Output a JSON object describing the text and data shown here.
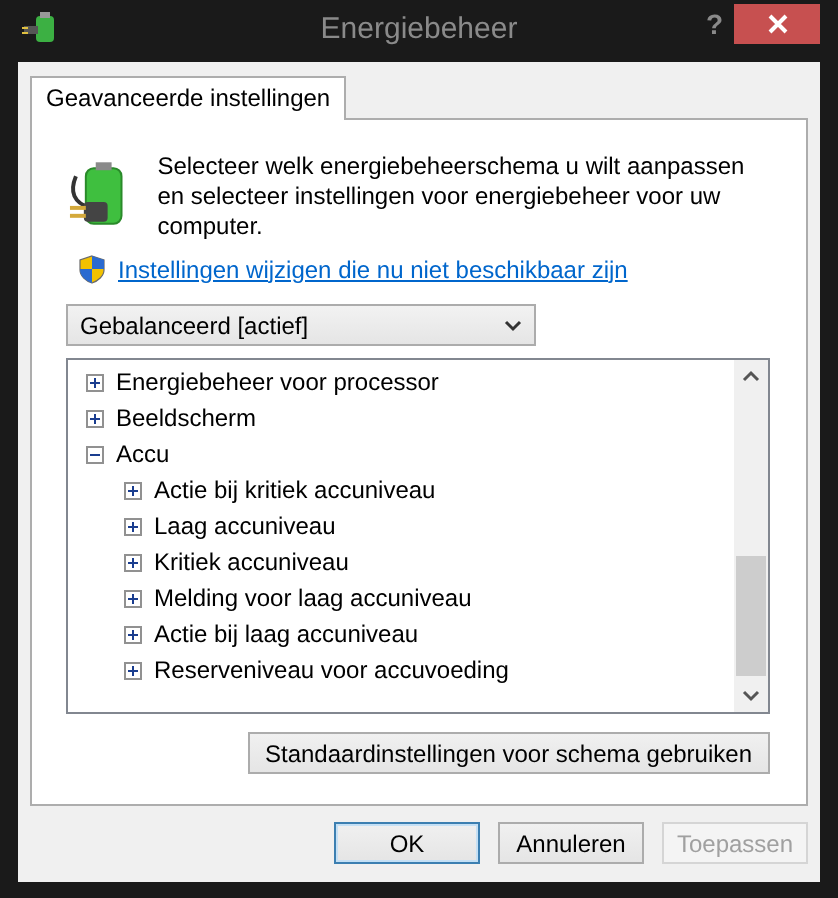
{
  "window": {
    "title": "Energiebeheer",
    "help": "?"
  },
  "tabs": [
    {
      "label": "Geavanceerde instellingen",
      "selected": true
    }
  ],
  "intro": "Selecteer welk energiebeheerschema u wilt aanpassen en selecteer instellingen voor energiebeheer voor uw computer.",
  "link": "Instellingen wijzigen die nu niet beschikbaar zijn",
  "plan_dropdown": {
    "value": "Gebalanceerd [actief]"
  },
  "tree": [
    {
      "label": "Energiebeheer voor processor",
      "expanded": false
    },
    {
      "label": "Beeldscherm",
      "expanded": false
    },
    {
      "label": "Accu",
      "expanded": true,
      "children": [
        {
          "label": "Actie bij kritiek accuniveau",
          "expanded": false
        },
        {
          "label": "Laag accuniveau",
          "expanded": false
        },
        {
          "label": "Kritiek accuniveau",
          "expanded": false
        },
        {
          "label": "Melding voor laag accuniveau",
          "expanded": false
        },
        {
          "label": "Actie bij laag accuniveau",
          "expanded": false
        },
        {
          "label": "Reserveniveau voor accuvoeding",
          "expanded": false
        }
      ]
    }
  ],
  "restore_button": "Standaardinstellingen voor schema gebruiken",
  "buttons": [
    {
      "label": "OK",
      "default": true,
      "disabled": false
    },
    {
      "label": "Annuleren",
      "default": false,
      "disabled": false
    },
    {
      "label": "Toepassen",
      "default": false,
      "disabled": true
    }
  ]
}
